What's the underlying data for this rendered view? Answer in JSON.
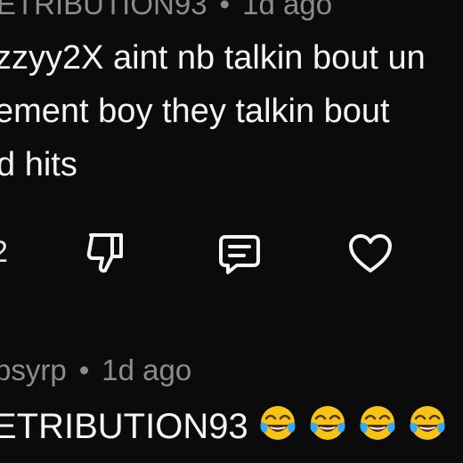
{
  "comment": {
    "author_partial": "ETRIBUTION93",
    "time": "1d ago",
    "separator": "•",
    "lines": [
      "zzyy2X aint nb talkin bout un",
      "ement boy they talkin bout",
      "d hits"
    ],
    "like_count_partial": "2"
  },
  "actions": {
    "icons": [
      "thumbs-down-icon",
      "comment-icon",
      "heart-icon"
    ]
  },
  "reply": {
    "author_partial": "bsyrp",
    "time": "1d ago",
    "separator": "•",
    "text": "ETRIBUTION93",
    "emoji_icon": "face-with-tears-of-joy-icon",
    "emoji_count": 4
  },
  "colors": {
    "background": "#0b0b0c",
    "text": "#f4f4f4",
    "meta": "#8b8b90",
    "emoji_face": "#f6c21c",
    "emoji_tears": "#3da7f0"
  }
}
